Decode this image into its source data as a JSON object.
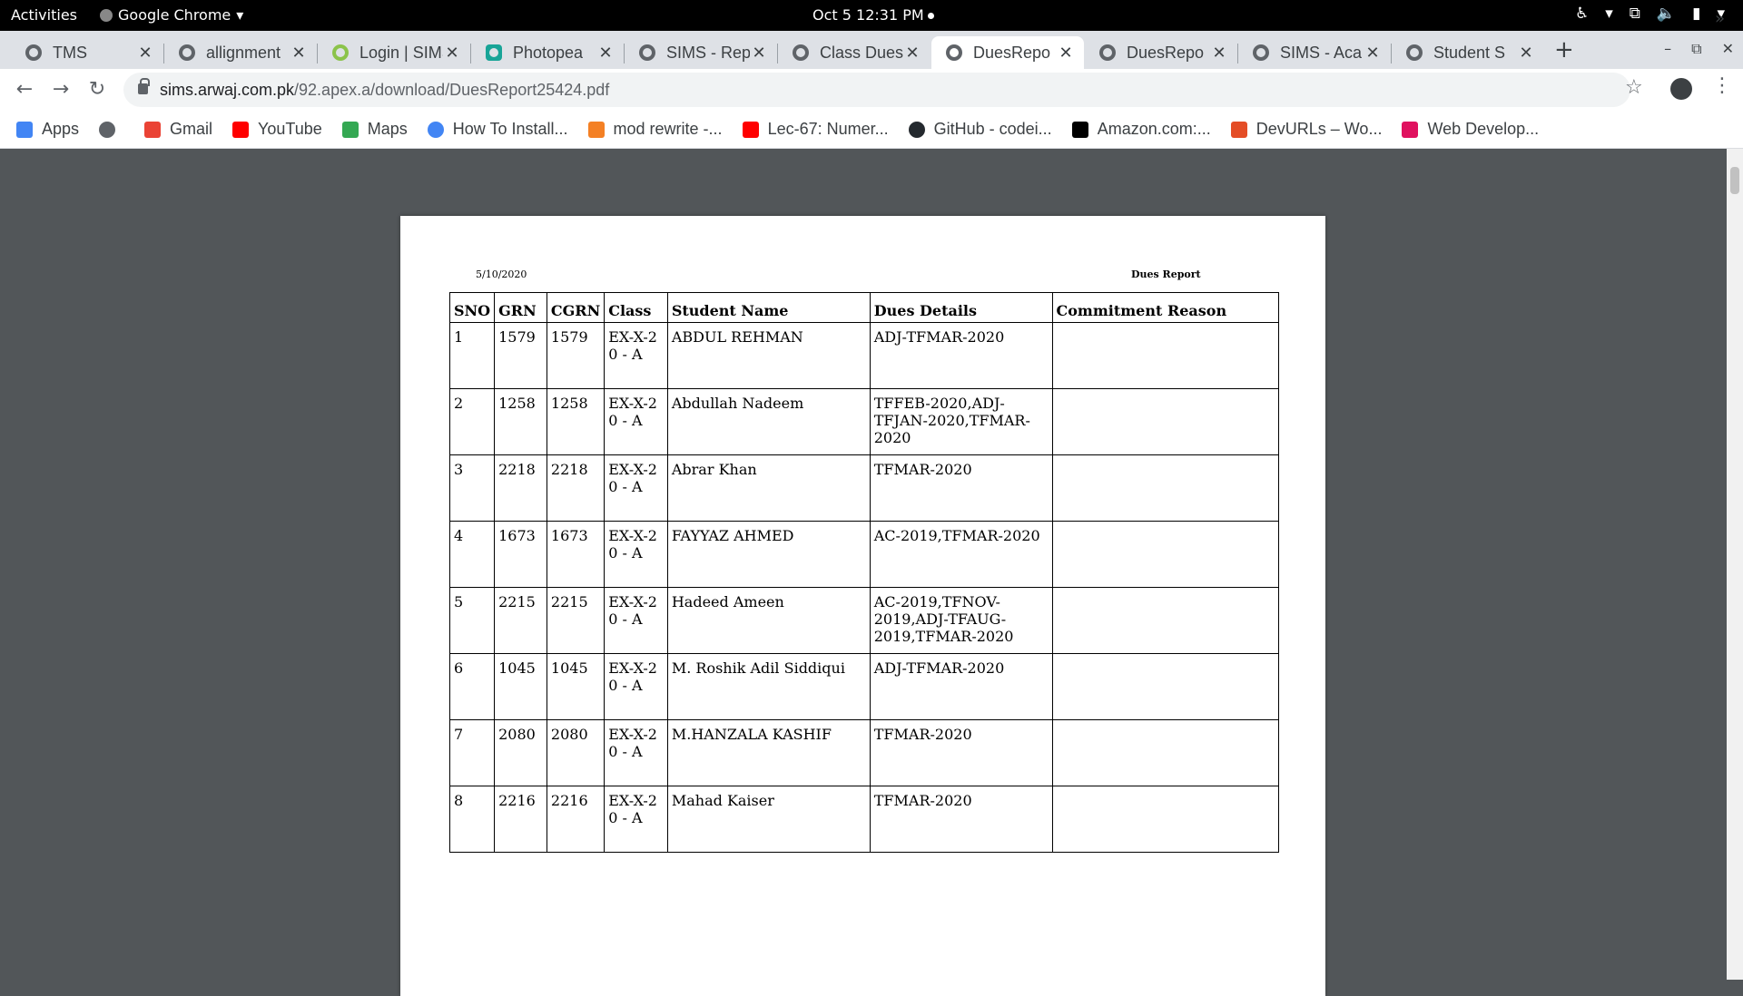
{
  "topbar": {
    "activities": "Activities",
    "app_name": "Google Chrome",
    "clock": "Oct 5  12:31 PM"
  },
  "tabs": [
    {
      "label": "TMS",
      "active": false
    },
    {
      "label": "allignment",
      "active": false
    },
    {
      "label": "Login | SIMS",
      "active": false
    },
    {
      "label": "Photopea",
      "active": false
    },
    {
      "label": "SIMS - Rep",
      "active": false
    },
    {
      "label": "Class Dues",
      "active": false
    },
    {
      "label": "DuesRepo",
      "active": true
    },
    {
      "label": "DuesRepo",
      "active": false
    },
    {
      "label": "SIMS - Aca",
      "active": false
    },
    {
      "label": "Student S",
      "active": false
    }
  ],
  "toolbar": {
    "url_host": "sims.arwaj.com.pk",
    "url_path": "/92.apex.a/download/DuesReport25424.pdf"
  },
  "bookmarks": [
    {
      "label": "Apps",
      "icon": "apps-grid-icon",
      "color": "#4285f4"
    },
    {
      "label": "",
      "icon": "globe-icon",
      "color": "#5f6368"
    },
    {
      "label": "Gmail",
      "icon": "gmail-icon",
      "color": "#ea4335"
    },
    {
      "label": "YouTube",
      "icon": "youtube-icon",
      "color": "#ff0000"
    },
    {
      "label": "Maps",
      "icon": "maps-pin-icon",
      "color": "#34a853"
    },
    {
      "label": "How To Install...",
      "icon": "loading-icon",
      "color": "#4285f4"
    },
    {
      "label": "mod rewrite -...",
      "icon": "stack-icon",
      "color": "#f48024"
    },
    {
      "label": "Lec-67: Numer...",
      "icon": "youtube-icon",
      "color": "#ff0000"
    },
    {
      "label": "GitHub - codei...",
      "icon": "github-icon",
      "color": "#24292e"
    },
    {
      "label": "Amazon.com:...",
      "icon": "amazon-icon",
      "color": "#000000"
    },
    {
      "label": "DevURLs – Wo...",
      "icon": "devurls-icon",
      "color": "#e44d26"
    },
    {
      "label": "Web Develop...",
      "icon": "web-dev-icon",
      "color": "#e0115f"
    }
  ],
  "report": {
    "date": "5/10/2020",
    "title": "Dues Report",
    "headers": [
      "SNO",
      "GRN",
      "CGRN",
      "Class",
      "Student Name",
      "Dues Details",
      "Commitment Reason"
    ],
    "rows": [
      {
        "sno": "1",
        "grn": "1579",
        "cgrn": "1579",
        "class": "EX-X-20 - A",
        "name": "ABDUL REHMAN",
        "dues": "ADJ-TFMAR-2020",
        "reason": ""
      },
      {
        "sno": "2",
        "grn": "1258",
        "cgrn": "1258",
        "class": "EX-X-20 - A",
        "name": "Abdullah Nadeem",
        "dues": "TFFEB-2020,ADJ-TFJAN-2020,TFMAR-2020",
        "reason": ""
      },
      {
        "sno": "3",
        "grn": "2218",
        "cgrn": "2218",
        "class": "EX-X-20 - A",
        "name": "Abrar Khan",
        "dues": "TFMAR-2020",
        "reason": ""
      },
      {
        "sno": "4",
        "grn": "1673",
        "cgrn": "1673",
        "class": "EX-X-20 - A",
        "name": "FAYYAZ AHMED",
        "dues": "AC-2019,TFMAR-2020",
        "reason": ""
      },
      {
        "sno": "5",
        "grn": "2215",
        "cgrn": "2215",
        "class": "EX-X-20 - A",
        "name": "Hadeed Ameen",
        "dues": "AC-2019,TFNOV-2019,ADJ-TFAUG-2019,TFMAR-2020",
        "reason": ""
      },
      {
        "sno": "6",
        "grn": "1045",
        "cgrn": "1045",
        "class": "EX-X-20 - A",
        "name": "M. Roshik Adil Siddiqui",
        "dues": "ADJ-TFMAR-2020",
        "reason": ""
      },
      {
        "sno": "7",
        "grn": "2080",
        "cgrn": "2080",
        "class": "EX-X-20 - A",
        "name": "M.HANZALA KASHIF",
        "dues": "TFMAR-2020",
        "reason": ""
      },
      {
        "sno": "8",
        "grn": "2216",
        "cgrn": "2216",
        "class": "EX-X-20 - A",
        "name": "Mahad Kaiser",
        "dues": "TFMAR-2020",
        "reason": ""
      }
    ]
  }
}
